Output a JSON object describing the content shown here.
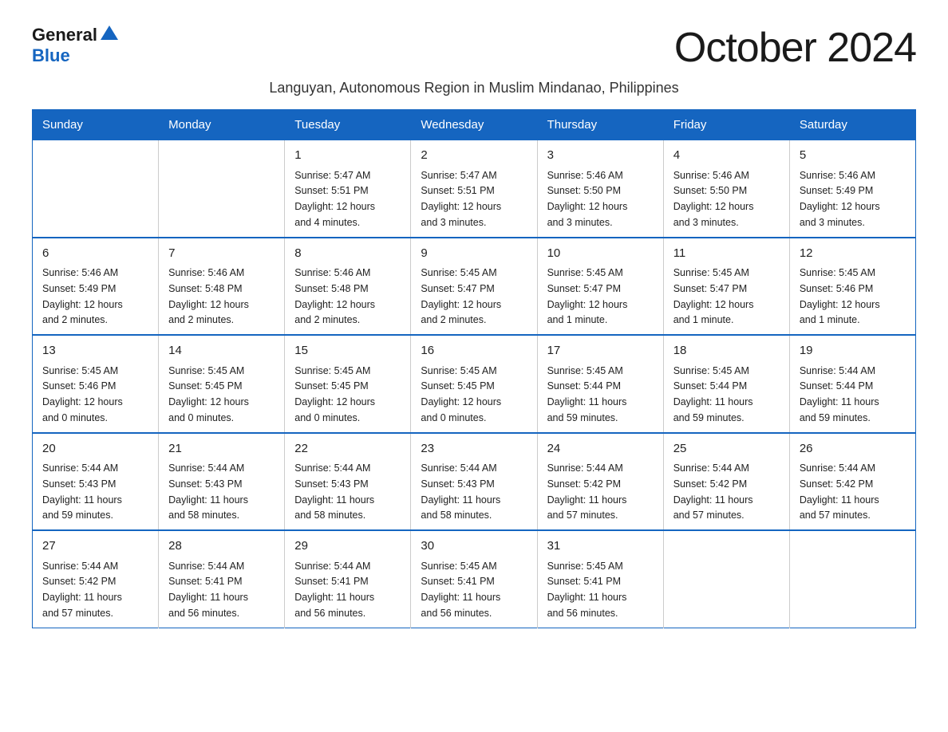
{
  "header": {
    "logo_general": "General",
    "logo_blue": "Blue",
    "month_title": "October 2024",
    "subtitle": "Languyan, Autonomous Region in Muslim Mindanao, Philippines"
  },
  "weekdays": [
    "Sunday",
    "Monday",
    "Tuesday",
    "Wednesday",
    "Thursday",
    "Friday",
    "Saturday"
  ],
  "weeks": [
    [
      {
        "day": "",
        "info": ""
      },
      {
        "day": "",
        "info": ""
      },
      {
        "day": "1",
        "info": "Sunrise: 5:47 AM\nSunset: 5:51 PM\nDaylight: 12 hours\nand 4 minutes."
      },
      {
        "day": "2",
        "info": "Sunrise: 5:47 AM\nSunset: 5:51 PM\nDaylight: 12 hours\nand 3 minutes."
      },
      {
        "day": "3",
        "info": "Sunrise: 5:46 AM\nSunset: 5:50 PM\nDaylight: 12 hours\nand 3 minutes."
      },
      {
        "day": "4",
        "info": "Sunrise: 5:46 AM\nSunset: 5:50 PM\nDaylight: 12 hours\nand 3 minutes."
      },
      {
        "day": "5",
        "info": "Sunrise: 5:46 AM\nSunset: 5:49 PM\nDaylight: 12 hours\nand 3 minutes."
      }
    ],
    [
      {
        "day": "6",
        "info": "Sunrise: 5:46 AM\nSunset: 5:49 PM\nDaylight: 12 hours\nand 2 minutes."
      },
      {
        "day": "7",
        "info": "Sunrise: 5:46 AM\nSunset: 5:48 PM\nDaylight: 12 hours\nand 2 minutes."
      },
      {
        "day": "8",
        "info": "Sunrise: 5:46 AM\nSunset: 5:48 PM\nDaylight: 12 hours\nand 2 minutes."
      },
      {
        "day": "9",
        "info": "Sunrise: 5:45 AM\nSunset: 5:47 PM\nDaylight: 12 hours\nand 2 minutes."
      },
      {
        "day": "10",
        "info": "Sunrise: 5:45 AM\nSunset: 5:47 PM\nDaylight: 12 hours\nand 1 minute."
      },
      {
        "day": "11",
        "info": "Sunrise: 5:45 AM\nSunset: 5:47 PM\nDaylight: 12 hours\nand 1 minute."
      },
      {
        "day": "12",
        "info": "Sunrise: 5:45 AM\nSunset: 5:46 PM\nDaylight: 12 hours\nand 1 minute."
      }
    ],
    [
      {
        "day": "13",
        "info": "Sunrise: 5:45 AM\nSunset: 5:46 PM\nDaylight: 12 hours\nand 0 minutes."
      },
      {
        "day": "14",
        "info": "Sunrise: 5:45 AM\nSunset: 5:45 PM\nDaylight: 12 hours\nand 0 minutes."
      },
      {
        "day": "15",
        "info": "Sunrise: 5:45 AM\nSunset: 5:45 PM\nDaylight: 12 hours\nand 0 minutes."
      },
      {
        "day": "16",
        "info": "Sunrise: 5:45 AM\nSunset: 5:45 PM\nDaylight: 12 hours\nand 0 minutes."
      },
      {
        "day": "17",
        "info": "Sunrise: 5:45 AM\nSunset: 5:44 PM\nDaylight: 11 hours\nand 59 minutes."
      },
      {
        "day": "18",
        "info": "Sunrise: 5:45 AM\nSunset: 5:44 PM\nDaylight: 11 hours\nand 59 minutes."
      },
      {
        "day": "19",
        "info": "Sunrise: 5:44 AM\nSunset: 5:44 PM\nDaylight: 11 hours\nand 59 minutes."
      }
    ],
    [
      {
        "day": "20",
        "info": "Sunrise: 5:44 AM\nSunset: 5:43 PM\nDaylight: 11 hours\nand 59 minutes."
      },
      {
        "day": "21",
        "info": "Sunrise: 5:44 AM\nSunset: 5:43 PM\nDaylight: 11 hours\nand 58 minutes."
      },
      {
        "day": "22",
        "info": "Sunrise: 5:44 AM\nSunset: 5:43 PM\nDaylight: 11 hours\nand 58 minutes."
      },
      {
        "day": "23",
        "info": "Sunrise: 5:44 AM\nSunset: 5:43 PM\nDaylight: 11 hours\nand 58 minutes."
      },
      {
        "day": "24",
        "info": "Sunrise: 5:44 AM\nSunset: 5:42 PM\nDaylight: 11 hours\nand 57 minutes."
      },
      {
        "day": "25",
        "info": "Sunrise: 5:44 AM\nSunset: 5:42 PM\nDaylight: 11 hours\nand 57 minutes."
      },
      {
        "day": "26",
        "info": "Sunrise: 5:44 AM\nSunset: 5:42 PM\nDaylight: 11 hours\nand 57 minutes."
      }
    ],
    [
      {
        "day": "27",
        "info": "Sunrise: 5:44 AM\nSunset: 5:42 PM\nDaylight: 11 hours\nand 57 minutes."
      },
      {
        "day": "28",
        "info": "Sunrise: 5:44 AM\nSunset: 5:41 PM\nDaylight: 11 hours\nand 56 minutes."
      },
      {
        "day": "29",
        "info": "Sunrise: 5:44 AM\nSunset: 5:41 PM\nDaylight: 11 hours\nand 56 minutes."
      },
      {
        "day": "30",
        "info": "Sunrise: 5:45 AM\nSunset: 5:41 PM\nDaylight: 11 hours\nand 56 minutes."
      },
      {
        "day": "31",
        "info": "Sunrise: 5:45 AM\nSunset: 5:41 PM\nDaylight: 11 hours\nand 56 minutes."
      },
      {
        "day": "",
        "info": ""
      },
      {
        "day": "",
        "info": ""
      }
    ]
  ]
}
